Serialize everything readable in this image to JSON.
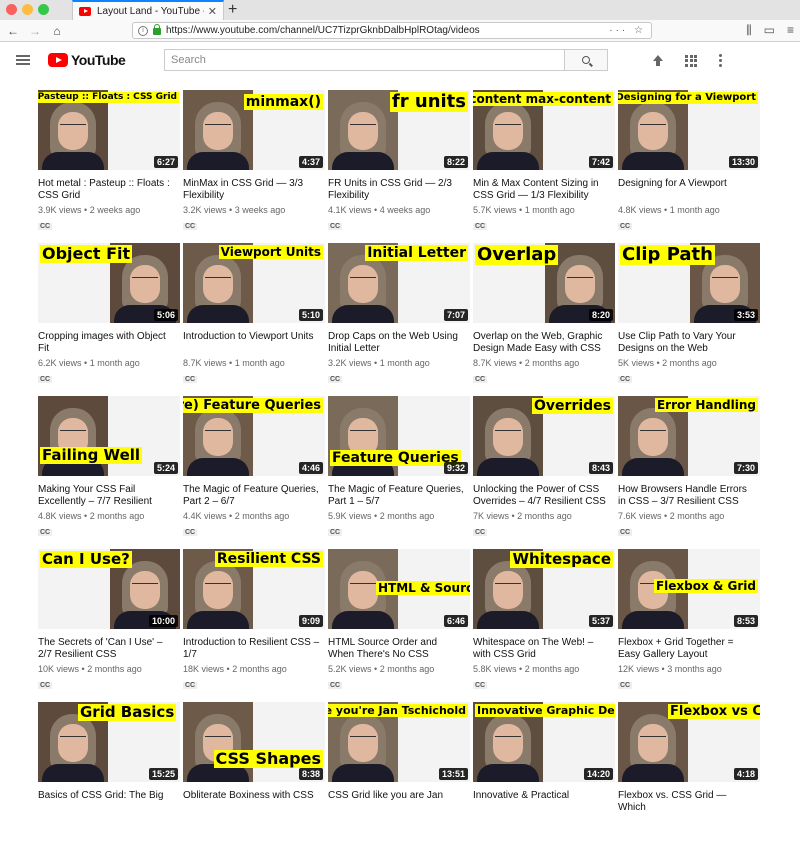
{
  "browser": {
    "tab_title": "Layout Land - YouTube - YouTu",
    "tab_close": "✕",
    "new_tab": "+",
    "url": "https://www.youtube.com/channel/UC7TizprGknbDalbHplROtag/videos",
    "url_actions": "··· ☆",
    "traffic_colors": [
      "#fc605c",
      "#fdbc40",
      "#34c84a"
    ]
  },
  "header": {
    "logo_text": "YouTube",
    "search_placeholder": "Search"
  },
  "videos": [
    {
      "title": "Hot metal : Pasteup :: Floats : CSS Grid",
      "views": "3.9K views",
      "age": "2 weeks ago",
      "duration": "6:27",
      "label": "Hot metal : Pasteup :: Floats : CSS Grid",
      "cc": "CC"
    },
    {
      "title": "MinMax in CSS Grid — 3/3 Flexibility",
      "views": "3.2K views",
      "age": "3 weeks ago",
      "duration": "4:37",
      "label": "minmax()",
      "cc": "CC"
    },
    {
      "title": "FR Units in CSS Grid — 2/3 Flexibility",
      "views": "4.1K views",
      "age": "4 weeks ago",
      "duration": "8:22",
      "label": "fr units",
      "cc": "CC"
    },
    {
      "title": "Min & Max Content Sizing in CSS Grid — 1/3 Flexibility",
      "views": "5.7K views",
      "age": "1 month ago",
      "duration": "7:42",
      "label": "min-content max-content",
      "cc": "CC"
    },
    {
      "title": "Designing for A Viewport",
      "views": "4.8K views",
      "age": "1 month ago",
      "duration": "13:30",
      "label": "Designing for a Viewport",
      "cc": "CC"
    },
    {
      "title": "Cropping images with Object Fit",
      "views": "6.2K views",
      "age": "1 month ago",
      "duration": "5:06",
      "label": "Object Fit",
      "cc": "CC"
    },
    {
      "title": "Introduction to Viewport Units",
      "views": "8.7K views",
      "age": "1 month ago",
      "duration": "5:10",
      "label": "Viewport Units",
      "cc": "CC"
    },
    {
      "title": "Drop Caps on the Web Using Initial Letter",
      "views": "3.2K views",
      "age": "1 month ago",
      "duration": "7:07",
      "label": "Initial Letter",
      "cc": "CC"
    },
    {
      "title": "Overlap on the Web, Graphic Design Made Easy with CSS",
      "views": "8.7K views",
      "age": "2 months ago",
      "duration": "8:20",
      "label": "Overlap",
      "cc": "CC"
    },
    {
      "title": "Use Clip Path to Vary Your Designs on the Web",
      "views": "5K views",
      "age": "2 months ago",
      "duration": "3:53",
      "label": "Clip Path",
      "cc": "CC"
    },
    {
      "title": "Making Your CSS Fail Excellently – 7/7 Resilient",
      "views": "4.8K views",
      "age": "2 months ago",
      "duration": "5:24",
      "label": "Failing Well",
      "cc": "CC"
    },
    {
      "title": "The Magic of Feature Queries, Part 2 – 6/7",
      "views": "4.4K views",
      "age": "2 months ago",
      "duration": "4:46",
      "label": "(more) Feature Queries",
      "cc": "CC"
    },
    {
      "title": "The Magic of Feature Queries, Part 1 – 5/7",
      "views": "5.9K views",
      "age": "2 months ago",
      "duration": "9:32",
      "label": "Feature Queries",
      "cc": "CC"
    },
    {
      "title": "Unlocking the Power of CSS Overrides – 4/7 Resilient CSS",
      "views": "7K views",
      "age": "2 months ago",
      "duration": "8:43",
      "label": "Overrides",
      "cc": "CC"
    },
    {
      "title": "How Browsers Handle Errors in CSS – 3/7 Resilient CSS",
      "views": "7.6K views",
      "age": "2 months ago",
      "duration": "7:30",
      "label": "Error Handling",
      "cc": "CC"
    },
    {
      "title": "The Secrets of 'Can I Use' – 2/7 Resilient CSS",
      "views": "10K views",
      "age": "2 months ago",
      "duration": "10:00",
      "label": "Can I Use?",
      "cc": "CC"
    },
    {
      "title": "Introduction to Resilient CSS – 1/7",
      "views": "18K views",
      "age": "2 months ago",
      "duration": "9:09",
      "label": "Resilient CSS",
      "cc": "CC"
    },
    {
      "title": "HTML Source Order and When There's No CSS",
      "views": "5.2K views",
      "age": "2 months ago",
      "duration": "6:46",
      "label": "HTML & Source Order",
      "cc": "CC"
    },
    {
      "title": "Whitespace on The Web! – with CSS Grid",
      "views": "5.8K views",
      "age": "2 months ago",
      "duration": "5:37",
      "label": "Whitespace",
      "cc": "CC"
    },
    {
      "title": "Flexbox + Grid Together = Easy Gallery Layout",
      "views": "12K views",
      "age": "3 months ago",
      "duration": "8:53",
      "label": "Flexbox & Grid",
      "cc": "CC"
    },
    {
      "title": "Basics of CSS Grid: The Big",
      "views": "",
      "age": "",
      "duration": "15:25",
      "label": "Grid Basics",
      "cc": ""
    },
    {
      "title": "Obliterate Boxiness with CSS",
      "views": "",
      "age": "",
      "duration": "8:38",
      "label": "CSS Shapes",
      "cc": ""
    },
    {
      "title": "CSS Grid like you are Jan",
      "views": "",
      "age": "",
      "duration": "13:51",
      "label": "Grid like you're Jan Tschichold",
      "cc": ""
    },
    {
      "title": "Innovative & Practical",
      "views": "",
      "age": "",
      "duration": "14:20",
      "label": "Innovative Graphic Design",
      "cc": ""
    },
    {
      "title": "Flexbox vs. CSS Grid — Which",
      "views": "",
      "age": "",
      "duration": "4:18",
      "label": "Flexbox vs CSS Grid",
      "cc": ""
    }
  ]
}
